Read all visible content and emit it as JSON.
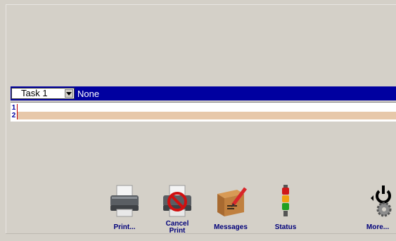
{
  "task": {
    "selected": "Task 1",
    "job_name": "None"
  },
  "lines": [
    {
      "number": "1"
    },
    {
      "number": "2"
    }
  ],
  "toolbar": {
    "print_label": "Print...",
    "cancel_label_1": "Cancel",
    "cancel_label_2": "Print",
    "messages_label": "Messages",
    "status_label": "Status",
    "more_label": "More..."
  },
  "colors": {
    "task_bar": "#0000a0",
    "line_highlight": "#e7c8aa",
    "background": "#d4d0c8"
  }
}
